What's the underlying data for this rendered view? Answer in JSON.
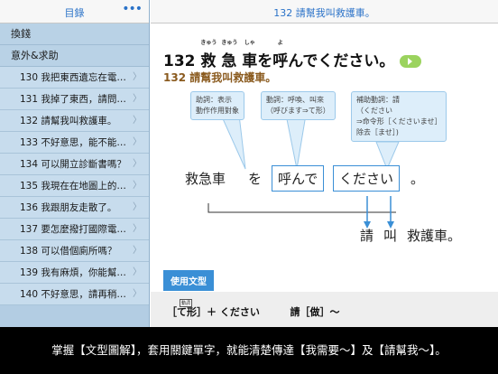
{
  "sidebar": {
    "title": "目錄",
    "more_icon": "•••",
    "categories": [
      "換錢",
      "意外&求助"
    ],
    "items": [
      "130 我把東西遺忘在電…",
      "131 我掉了東西，請問…",
      "132 請幫我叫救護車。",
      "133 不好意思，能不能…",
      "134 可以開立診斷書嗎？",
      "135 我現在在地圖上的…",
      "136 我跟朋友走散了。",
      "137 要怎麼撥打國際電…",
      "138 可以借個廁所嗎？",
      "139 我有麻煩，你能幫…",
      "140 不好意思，請再稍…"
    ],
    "chevron": "〉"
  },
  "topbar": {
    "title": "132 請幫我叫救護車。"
  },
  "lesson": {
    "number": "132",
    "ja_part1": "救",
    "ja_part1_ruby": "きゅう",
    "ja_part2": "急",
    "ja_part2_ruby": "きゅう",
    "ja_part3": "車",
    "ja_part3_ruby": "しゃ",
    "ja_part4": "を",
    "ja_part5": "呼",
    "ja_part5_ruby": "よ",
    "ja_part6": "んでください。",
    "zh": "132 請幫我叫救護車。"
  },
  "notes": {
    "n1_line1": "助詞：表示",
    "n1_line2": "動作作用對象",
    "n2_line1": "動詞：呼喚、叫來",
    "n2_line2": "（呼びます⇒て形）",
    "n3_line1": "補助動詞：請",
    "n3_line2": "（ください",
    "n3_line3": "⇒命令形［くださいませ］",
    "n3_line4": "除去［ませ］)"
  },
  "sentence": {
    "w1": "救急車",
    "w2": "を",
    "w3": "呼んで",
    "w4": "ください",
    "w5": "。"
  },
  "translation": {
    "t1": "請",
    "t2": "叫",
    "t3": "救護車。"
  },
  "grammar": {
    "tab": "使用文型",
    "ruby": "動詞",
    "pattern": "［て形］＋ ください",
    "meaning": "請［做］～"
  },
  "caption": "掌握【文型圖解】，套用關鍵單字，就能清楚傳達【我需要～】及【請幫我～】。",
  "colors": {
    "accent_blue": "#2a72c8",
    "speaker_green": "#9bd35e",
    "zh_brown": "#8a5a1e"
  }
}
